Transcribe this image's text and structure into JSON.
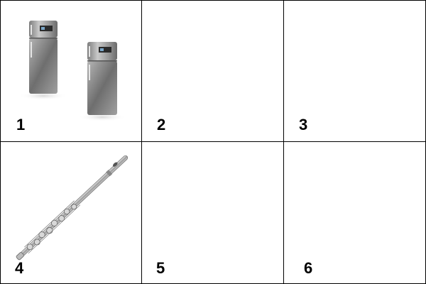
{
  "cells": [
    {
      "label": "1",
      "image": "refrigerator-pair"
    },
    {
      "label": "2",
      "image": ""
    },
    {
      "label": "3",
      "image": ""
    },
    {
      "label": "4",
      "image": "flute"
    },
    {
      "label": "5",
      "image": ""
    },
    {
      "label": "6",
      "image": ""
    }
  ]
}
